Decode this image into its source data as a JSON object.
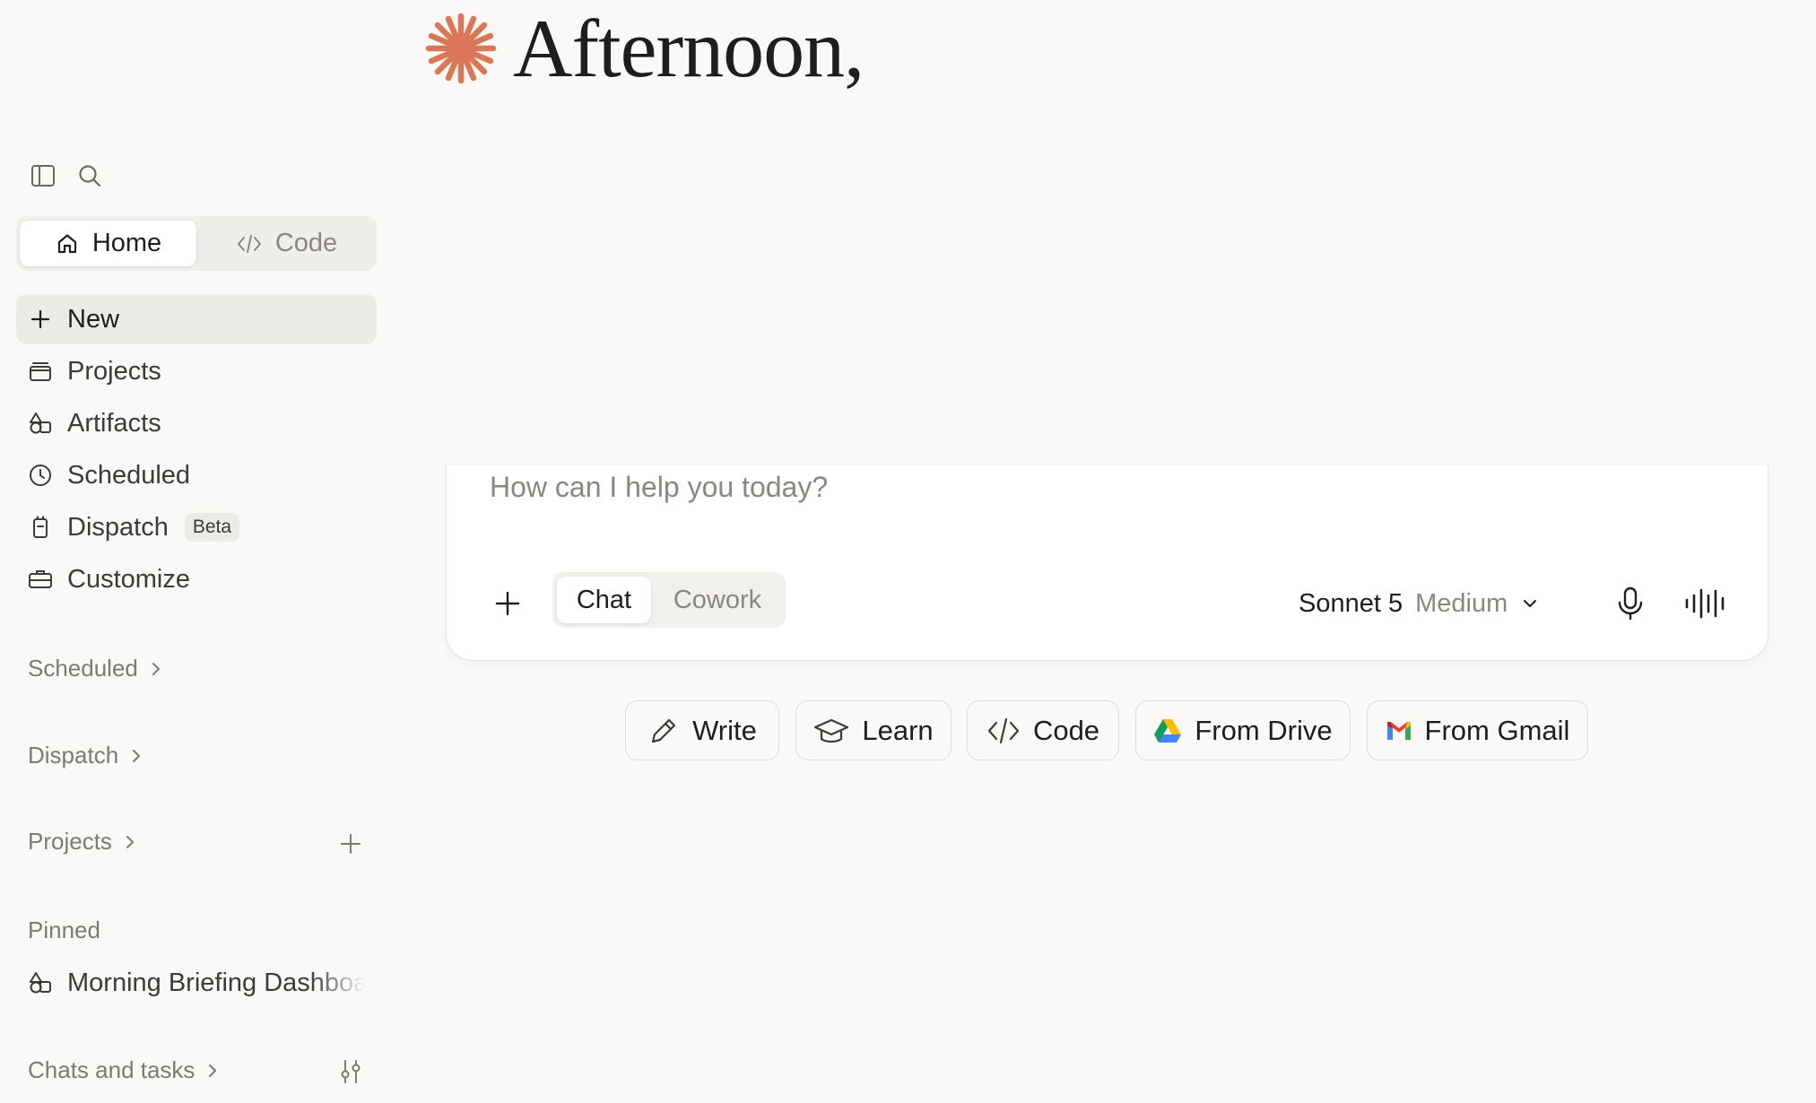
{
  "greeting": {
    "text": "Afternoon,"
  },
  "sidebar": {
    "segmented": {
      "home_label": "Home",
      "code_label": "Code"
    },
    "nav": [
      {
        "label": "New",
        "icon": "plus-icon",
        "active": true
      },
      {
        "label": "Projects",
        "icon": "projects-icon"
      },
      {
        "label": "Artifacts",
        "icon": "artifacts-icon"
      },
      {
        "label": "Scheduled",
        "icon": "clock-icon"
      },
      {
        "label": "Dispatch",
        "icon": "dispatch-icon",
        "badge": "Beta"
      },
      {
        "label": "Customize",
        "icon": "briefcase-icon"
      }
    ],
    "sections": {
      "scheduled": "Scheduled",
      "dispatch": "Dispatch",
      "projects": "Projects",
      "pinned": "Pinned",
      "chats": "Chats and tasks"
    },
    "pinned_items": [
      {
        "label": "Morning Briefing Dashboard",
        "icon": "artifacts-icon"
      }
    ]
  },
  "composer": {
    "placeholder": "How can I help you today?",
    "modes": {
      "chat": "Chat",
      "cowork": "Cowork"
    },
    "model": {
      "name": "Sonnet 5",
      "effort": "Medium"
    }
  },
  "quick_actions": [
    {
      "label": "Write",
      "icon": "pencil-icon"
    },
    {
      "label": "Learn",
      "icon": "graduation-cap-icon"
    },
    {
      "label": "Code",
      "icon": "code-icon"
    },
    {
      "label": "From Drive",
      "icon": "google-drive-icon"
    },
    {
      "label": "From Gmail",
      "icon": "gmail-icon"
    }
  ],
  "colors": {
    "accent": "#d97757",
    "background": "#faf9f7",
    "text": "#1f1e1d",
    "muted": "#8a8780"
  }
}
